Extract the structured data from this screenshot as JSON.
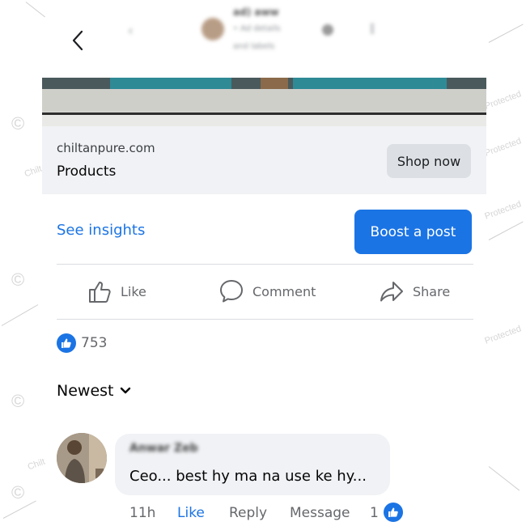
{
  "header": {
    "back_icon": "chevron-left-icon",
    "blurred_name": "ad) aww",
    "blurred_sub1": "• Ad details",
    "blurred_sub2": "and labels"
  },
  "watermarks": {
    "copyright_symbol": "©",
    "protected_text": "Protected",
    "brand_text": "Chilt"
  },
  "link_preview": {
    "domain": "chiltanpure.com",
    "title": "Products",
    "cta_label": "Shop now"
  },
  "insights": {
    "see_insights_label": "See insights",
    "boost_label": "Boost a post"
  },
  "actions": {
    "like_label": "Like",
    "comment_label": "Comment",
    "share_label": "Share"
  },
  "reactions": {
    "count": "753",
    "icon": "thumbs-up-icon"
  },
  "sort": {
    "label": "Newest",
    "icon": "chevron-down-icon"
  },
  "comment": {
    "author_blurred": "Anwar Zeb",
    "text": "Ceo... best hy ma na use ke hy...",
    "time": "11h",
    "like_label": "Like",
    "reply_label": "Reply",
    "message_label": "Message",
    "reaction_count": "1"
  },
  "colors": {
    "accent": "#1b74e4",
    "muted_text": "#65676b",
    "card_bg": "#f0f2f5"
  }
}
